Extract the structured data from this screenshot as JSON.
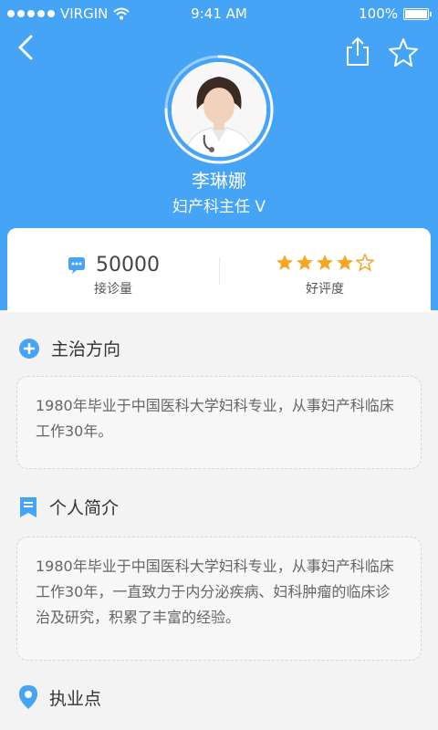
{
  "status": {
    "carrier": "VIRGIN",
    "time": "9:41 AM",
    "battery": "100%"
  },
  "colors": {
    "brand": "#46a4f7",
    "star": "#f5a623"
  },
  "nav": {
    "back_icon": "chevron-left-icon",
    "share_icon": "share-icon",
    "favorite_icon": "star-outline-icon"
  },
  "doctor": {
    "name": "李琳娜",
    "title": "妇产科主任 V"
  },
  "stats": {
    "consultations": {
      "value": "50000",
      "label": "接诊量",
      "icon": "chat-bubble-icon"
    },
    "rating": {
      "label": "好评度",
      "stars": 4,
      "max": 5
    }
  },
  "sections": {
    "specialty": {
      "title": "主治方向",
      "icon": "plus-circle-icon",
      "text": "1980年毕业于中国医科大学妇科专业，从事妇产科临床工作30年。"
    },
    "profile": {
      "title": "个人简介",
      "icon": "bookmark-icon",
      "text": "1980年毕业于中国医科大学妇科专业，从事妇产科临床工作30年，一直致力于内分泌疾病、妇科肿瘤的临床诊治及研究，积累了丰富的经验。"
    },
    "location": {
      "title": "执业点",
      "icon": "location-pin-icon"
    }
  }
}
